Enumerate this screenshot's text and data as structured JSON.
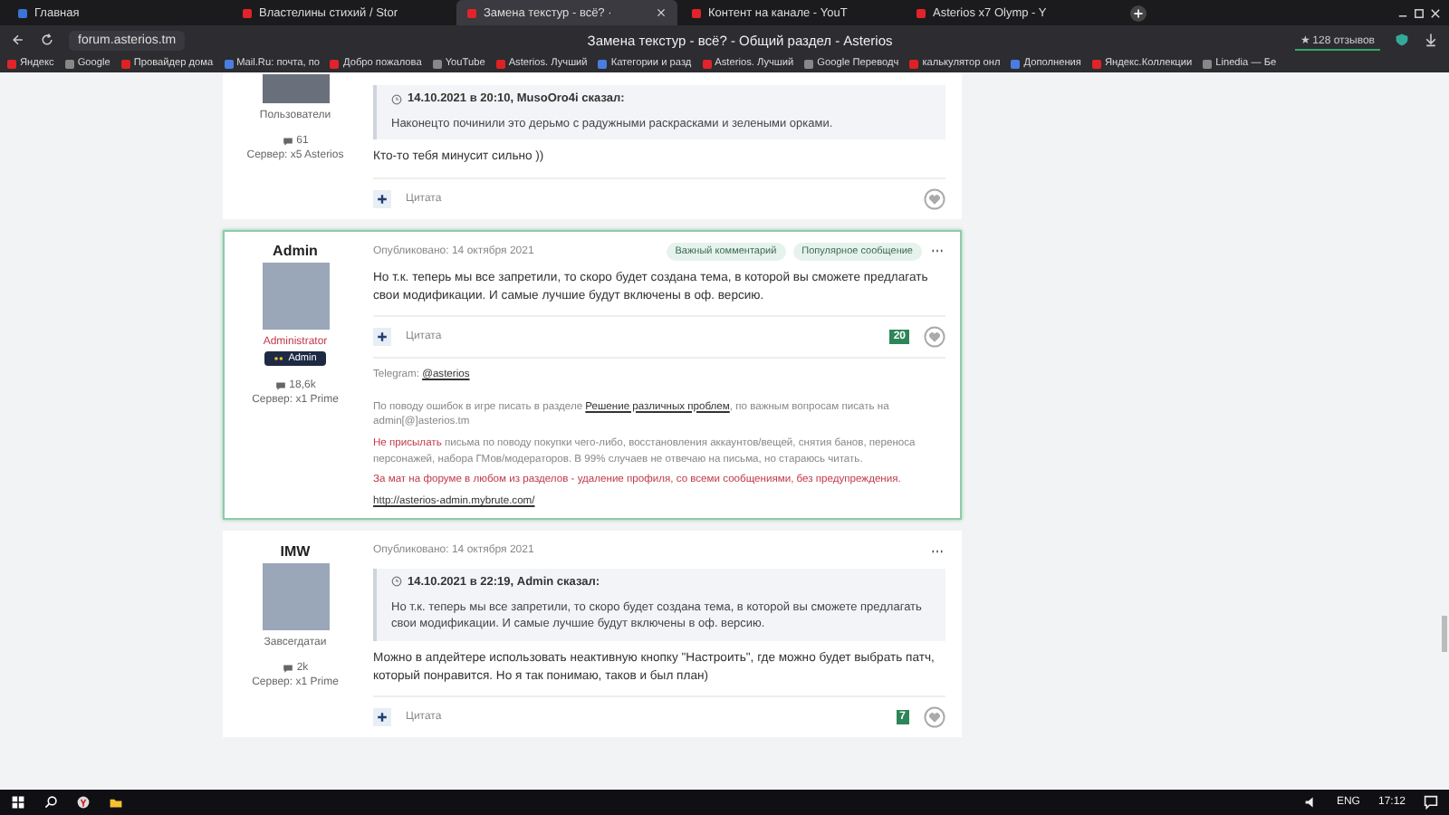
{
  "browser": {
    "tabs": [
      {
        "label": "Главная",
        "selected": false
      },
      {
        "label": "Властелины стихий / Stor",
        "selected": false
      },
      {
        "label": "Замена текстур - всё? ·",
        "selected": true
      },
      {
        "label": "Контент на канале - YouT",
        "selected": false
      },
      {
        "label": "Asterios x7 Olymp - Y",
        "selected": false
      }
    ],
    "address": "forum.asterios.tm",
    "page_title": "Замена текстур - всё? - Общий раздел - Asterios",
    "reviews": "★ 128 отзывов",
    "bookmarks": [
      "Яндекс",
      "Google",
      "Провайдер дома",
      "Mail.Ru: почта, по",
      "Добро пожалова",
      "YouTube",
      "Asterios. Лучший",
      "Категории и разд",
      "Asterios. Лучший",
      "Google Переводч",
      "калькулятор онл",
      "Дополнения",
      "Яндекс.Коллекции",
      "Linedia — Бе"
    ]
  },
  "posts": [
    {
      "kind": "member",
      "rank": "Пользователи",
      "count": "61",
      "server": "Сервер: x5 Asterios",
      "highlighted": false,
      "quote": {
        "header": "14.10.2021 в 20:10, MusoOro4i сказал:",
        "text": "Наконецто починили это дерьмо с радужными раскрасками и зелеными орками."
      },
      "body": "Кто-то тебя минусит сильно ))",
      "quote_button": "Цитата"
    },
    {
      "author": "Admin",
      "rank": "Administrator",
      "kind": "admin",
      "group": "Admin",
      "count": "18,6k",
      "server": "Сервер: x1 Prime",
      "highlighted": true,
      "date": "Опубликовано: 14 октября 2021",
      "badges": [
        "Важный комментарий",
        "Популярное сообщение"
      ],
      "body": "Но т.к. теперь мы все запретили, то скоро будет создана тема, в которой вы сможете предлагать свои модификации. И самые лучшие будут включены в оф. версию.",
      "quote_button": "Цитата",
      "likes": "20",
      "signature": [
        [
          {
            "kind": "text",
            "text": "Telegram: "
          },
          {
            "kind": "link",
            "text": "@asterios"
          }
        ],
        [
          {
            "kind": "text",
            "text": "По поводу ошибок в игре писать в разделе "
          },
          {
            "kind": "link",
            "text": "Решение различных проблем"
          },
          {
            "kind": "text",
            "text": ", по важным вопросам писать на admin[@]asterios.tm"
          }
        ],
        [
          {
            "kind": "warn",
            "text": "Не присылать"
          },
          {
            "kind": "text",
            "text": " письма по поводу покупки чего-либо, восстановления аккаунтов/вещей, снятия банов, переноса персонажей, набора ГМов/модераторов. В 99% случаев не отвечаю на письма, но стараюсь читать."
          }
        ],
        [
          {
            "kind": "warn",
            "text": "За мат на форуме в любом из разделов - удаление профиля, со всеми сообщениями, без предупреждения."
          }
        ],
        [
          {
            "kind": "link",
            "text": "http://asterios-admin.mybrute.com/"
          }
        ]
      ]
    },
    {
      "kind": "member",
      "author": "IMW",
      "rank": "Завсегдатаи",
      "count": "2k",
      "server": "Сервер: x1 Prime",
      "highlighted": false,
      "date": "Опубликовано: 14 октября 2021",
      "quote": {
        "header": "14.10.2021 в 22:19, Admin сказал:",
        "text": "Но т.к. теперь мы все запретили, то скоро будет создана тема, в которой вы сможете предлагать свои модификации. И самые лучшие будут включены в оф. версию."
      },
      "body": "Можно в апдейтере использовать неактивную кнопку \"Настроить\", где можно будет выбрать патч, который понравится. Но я так понимаю, таков и был план)",
      "quote_button": "Цитата",
      "likes": "7"
    }
  ],
  "taskbar": {
    "language": "ENG",
    "time": "17:12"
  }
}
